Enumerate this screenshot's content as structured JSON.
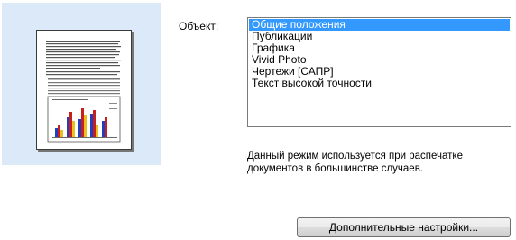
{
  "object_label": "Объект:",
  "object_list": {
    "items": [
      {
        "label": "Общие положения",
        "selected": true
      },
      {
        "label": "Публикации",
        "selected": false
      },
      {
        "label": "Графика",
        "selected": false
      },
      {
        "label": "Vivid Photo",
        "selected": false
      },
      {
        "label": "Чертежи [САПР]",
        "selected": false
      },
      {
        "label": "Текст высокой точности",
        "selected": false
      }
    ]
  },
  "description": "Данный режим используется при распечатке документов в большинстве случаев.",
  "advanced_button": "Дополнительные настройки...",
  "colors": {
    "preview_bg": "#dce9f8",
    "selection": "#3399ff"
  }
}
